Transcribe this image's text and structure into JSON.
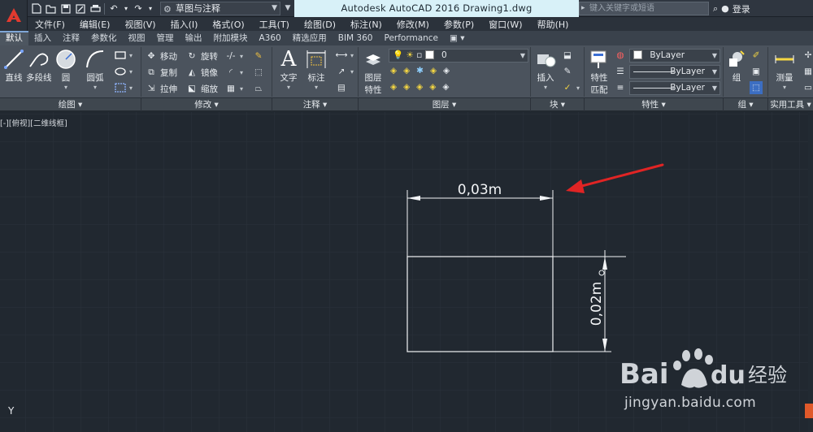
{
  "title_bar": {
    "workspace": "草图与注释",
    "document_title": "Autodesk AutoCAD 2016    Drawing1.dwg",
    "search_placeholder": "键入关键字或短语",
    "login_label": "登录"
  },
  "menu": [
    "文件(F)",
    "编辑(E)",
    "视图(V)",
    "插入(I)",
    "格式(O)",
    "工具(T)",
    "绘图(D)",
    "标注(N)",
    "修改(M)",
    "参数(P)",
    "窗口(W)",
    "帮助(H)"
  ],
  "tabs": [
    "默认",
    "插入",
    "注释",
    "参数化",
    "视图",
    "管理",
    "输出",
    "附加模块",
    "A360",
    "精选应用",
    "BIM 360",
    "Performance"
  ],
  "active_tab": "默认",
  "ribbon": {
    "draw": {
      "line": "直线",
      "polyline": "多段线",
      "circle": "圆",
      "arc": "圆弧",
      "panel": "绘图 ▾"
    },
    "modify": {
      "move": "移动",
      "rotate": "旋转",
      "copy": "复制",
      "mirror": "镜像",
      "stretch": "拉伸",
      "scale": "缩放",
      "panel": "修改 ▾"
    },
    "annotation": {
      "text": "文字",
      "dimension": "标注",
      "panel": "注释 ▾"
    },
    "layers": {
      "layer_props_1": "图层",
      "layer_props_2": "特性",
      "layer_value": "0",
      "panel": "图层 ▾"
    },
    "block": {
      "insert": "插入",
      "panel": "块 ▾"
    },
    "properties": {
      "match_1": "特性",
      "match_2": "匹配",
      "color": "ByLayer",
      "linetype": "ByLayer",
      "lineweight": "ByLayer",
      "panel": "特性 ▾"
    },
    "groups": {
      "group": "组",
      "panel": "组 ▾"
    },
    "utilities": {
      "measure": "测量",
      "panel": "实用工具 ▾"
    }
  },
  "canvas": {
    "viewport_label": "[-][俯视][二维线框]",
    "ucs_axis": "Y",
    "dim_horizontal": "0,03m",
    "dim_vertical": "0,02m"
  },
  "watermark": {
    "brand": "Bai du 经验",
    "url": "jingyan.baidu.com"
  },
  "colors": {
    "canvas_bg": "#212830",
    "ribbon_bg": "#4b535d",
    "title_highlight": "#d8f1f8",
    "annotation_arrow": "#e02424"
  }
}
